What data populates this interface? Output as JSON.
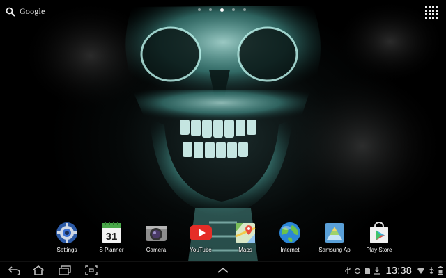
{
  "search": {
    "label": "Google"
  },
  "pages": {
    "count": 5,
    "active": 2
  },
  "dock": {
    "items": [
      {
        "name": "settings",
        "label": "Settings"
      },
      {
        "name": "s-planner",
        "label": "S Planner",
        "date": "31"
      },
      {
        "name": "camera",
        "label": "Camera"
      },
      {
        "name": "youtube",
        "label": "YouTube"
      },
      {
        "name": "maps",
        "label": "Maps"
      },
      {
        "name": "internet",
        "label": "Internet"
      },
      {
        "name": "samsung-apps",
        "label": "Samsung Ap"
      },
      {
        "name": "play-store",
        "label": "Play Store"
      }
    ]
  },
  "status": {
    "time": "13:38"
  },
  "colors": {
    "skull": "#9fe8e0",
    "skull_glow": "#4fd0c8",
    "youtube_red": "#e52d27",
    "nav_icon": "#bfbfbf"
  }
}
